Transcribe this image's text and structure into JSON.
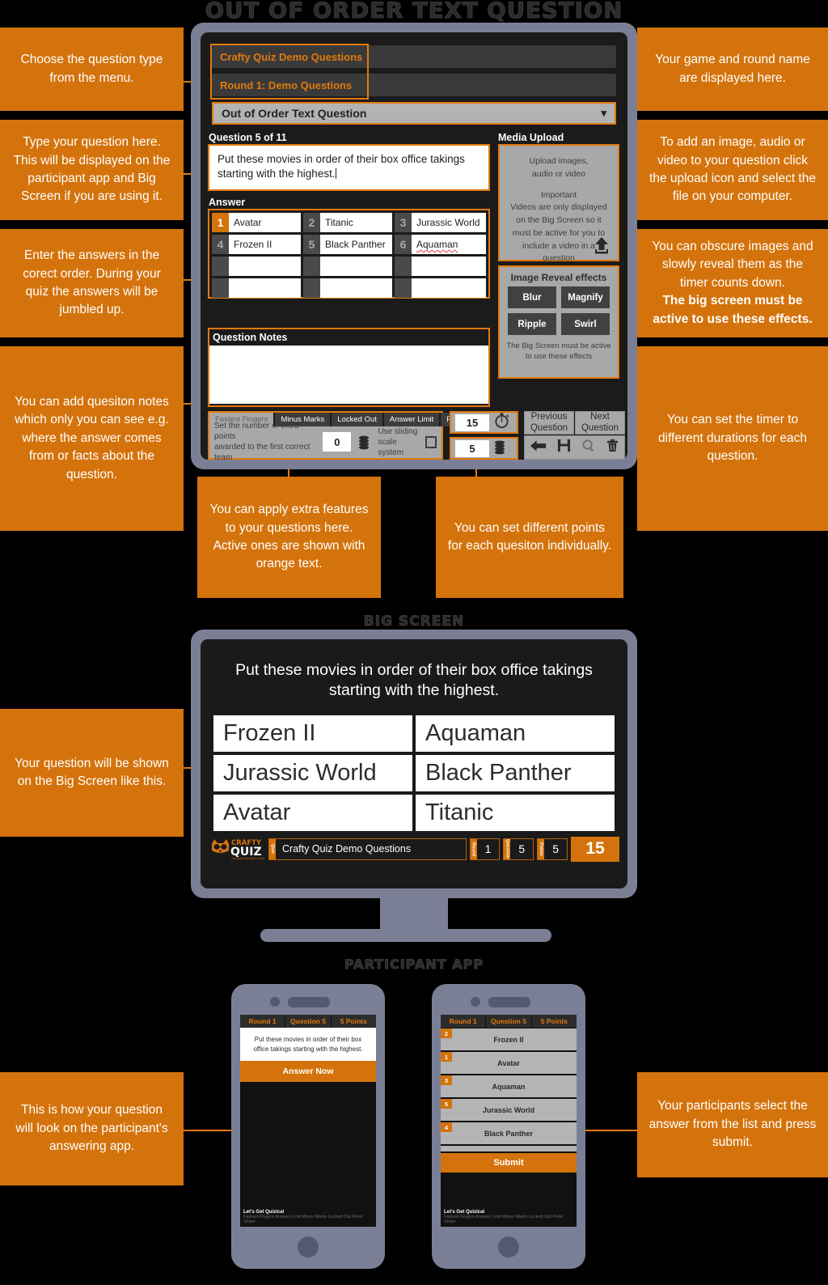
{
  "titles": {
    "main": "OUT OF ORDER TEXT QUESTION",
    "big_screen": "BIG SCREEN",
    "participant_app": "PARTICIPANT APP"
  },
  "colors": {
    "accent": "#d4730c",
    "accent_bright": "#e2790d",
    "bezel": "#7b7f96",
    "screen_dark": "#1a1a1a"
  },
  "editor": {
    "game_name": "Crafty Quiz Demo Questions",
    "round_name": "Round 1: Demo Questions",
    "question_type": "Out of Order Text Question",
    "question_counter": "Question 5 of 11",
    "question_text": "Put these movies in order of their box office takings starting with the highest.",
    "answer_label": "Answer",
    "answers": [
      {
        "num": "1",
        "text": "Avatar",
        "spellcheck": false
      },
      {
        "num": "2",
        "text": "Titanic",
        "spellcheck": false
      },
      {
        "num": "3",
        "text": "Jurassic World",
        "spellcheck": false
      },
      {
        "num": "4",
        "text": "Frozen II",
        "spellcheck": false
      },
      {
        "num": "5",
        "text": "Black Panther",
        "spellcheck": false
      },
      {
        "num": "6",
        "text": "Aquaman",
        "spellcheck": true
      },
      {
        "num": "",
        "text": "",
        "spellcheck": false
      },
      {
        "num": "",
        "text": "",
        "spellcheck": false
      },
      {
        "num": "",
        "text": "",
        "spellcheck": false
      },
      {
        "num": "",
        "text": "",
        "spellcheck": false
      },
      {
        "num": "",
        "text": "",
        "spellcheck": false
      },
      {
        "num": "",
        "text": "",
        "spellcheck": false
      }
    ],
    "notes_label": "Question Notes",
    "notes_value": "",
    "media": {
      "label": "Media Upload",
      "line1": "Upload images,",
      "line2": "audio or video",
      "important": "Important",
      "important_body": "Videos are only displayed on the Big Screen so it must be active for you to include a video in a question",
      "upload_icon": "upload-arrow-icon"
    },
    "effects": {
      "title": "Image Reveal effects",
      "buttons": [
        "Blur",
        "Magnify",
        "Ripple",
        "Swirl"
      ],
      "note": "The Big Screen must be active to use these effects"
    },
    "features": {
      "tabs": [
        "Fastest Fingers",
        "Minus Marks",
        "Locked Out",
        "Answer Limit",
        "Point Share"
      ],
      "active_tab": "Fastest Fingers",
      "description_line1": "Set the number of extra points",
      "description_line2": "awarded to the first correct team",
      "extra_points_value": "0",
      "sliding_label_line1": "Use sliding",
      "sliding_label_line2": "scale system",
      "sliding_checked": false
    },
    "timer_value": "15",
    "points_value": "5",
    "nav": {
      "previous_line1": "Previous",
      "previous_line2": "Question",
      "next_line1": "Next",
      "next_line2": "Question"
    },
    "icons": [
      "back-arrow-icon",
      "save-icon",
      "preview-icon",
      "delete-icon"
    ]
  },
  "big_screen": {
    "question_text": "Put these movies in order of their box office takings starting with the highest.",
    "options": [
      "Frozen II",
      "Aquaman",
      "Jurassic World",
      "Black Panther",
      "Avatar",
      "Titanic"
    ],
    "logo_top": "CRAFTY",
    "logo_bottom": "QUIZ",
    "logo_tag": "The quiz that doesn't quit",
    "footer": {
      "quiz_key": "Quiz",
      "quiz_value": "Crafty Quiz Demo Questions",
      "round_key": "Round",
      "round_value": "1",
      "question_key": "Question",
      "question_value": "5",
      "points_key": "Points",
      "points_value": "5",
      "timer_value": "15"
    }
  },
  "participant_app": {
    "tabs": [
      "Round 1",
      "Question 5",
      "5 Points"
    ],
    "question_text": "Put these movies in order of their box office takings starting with the highest.",
    "answer_now_label": "Answer Now",
    "selections": [
      {
        "rank": "2",
        "label": "Frozen II"
      },
      {
        "rank": "1",
        "label": "Avatar"
      },
      {
        "rank": "3",
        "label": "Aquaman"
      },
      {
        "rank": "5",
        "label": "Jurassic World"
      },
      {
        "rank": "4",
        "label": "Black Panther"
      }
    ],
    "submit_label": "Submit",
    "footer_title": "Let's Get Quizical",
    "footer_features": "Fastest Fingers  Answer Limit  Minus Marks  Locked Out  Point Share"
  },
  "callouts": {
    "c1": "Choose the question type from the menu.",
    "c2": "Type your question here. This will be displayed on the participant app and Big Screen if you are using it.",
    "c3": "Enter the answers in the corect order. During your quiz the answers will be jumbled up.",
    "c4": "You can add quesiton notes which only you can see e.g. where the answer comes from or facts about the question.",
    "c5": "Your game and round name are displayed here.",
    "c6": "To add an image, audio or video to your question click the upload icon and select the file on your computer.",
    "c7_normal": "You can obscure images and slowly reveal them as the timer counts down.",
    "c7_bold": "The big screen must be active to use these effects.",
    "c8": "You can set the timer to different durations for each question.",
    "c9": "You can apply extra features to your questions here. Active ones are shown with orange text.",
    "c10": "You can set different points for each quesiton individually.",
    "c11": "Your question will be shown on the Big Screen like this.",
    "c12": "This is how your question will look on the participant's answering app.",
    "c13": "Your participants select the answer from the list and press submit."
  }
}
